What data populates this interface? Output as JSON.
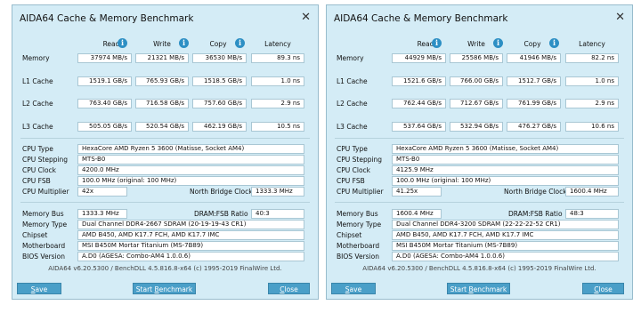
{
  "windows": [
    {
      "title": "AIDA64 Cache & Memory Benchmark",
      "close_glyph": "✕",
      "headers": [
        "Read",
        "Write",
        "Copy",
        "Latency"
      ],
      "info_glyph": "i",
      "rows": [
        {
          "label": "Memory",
          "read": "37974 MB/s",
          "write": "21321 MB/s",
          "copy": "36530 MB/s",
          "latency": "89.3 ns"
        },
        {
          "label": "L1 Cache",
          "read": "1519.1 GB/s",
          "write": "765.93 GB/s",
          "copy": "1518.5 GB/s",
          "latency": "1.0 ns"
        },
        {
          "label": "L2 Cache",
          "read": "763.40 GB/s",
          "write": "716.58 GB/s",
          "copy": "757.60 GB/s",
          "latency": "2.9 ns"
        },
        {
          "label": "L3 Cache",
          "read": "505.05 GB/s",
          "write": "520.54 GB/s",
          "copy": "462.19 GB/s",
          "latency": "10.5 ns"
        }
      ],
      "cpu": {
        "type_label": "CPU Type",
        "type": "HexaCore AMD Ryzen 5 3600  (Matisse, Socket AM4)",
        "stepping_label": "CPU Stepping",
        "stepping": "MTS-B0",
        "clock_label": "CPU Clock",
        "clock": "4200.0 MHz",
        "fsb_label": "CPU FSB",
        "fsb": "100.0 MHz  (original: 100 MHz)",
        "multiplier_label": "CPU Multiplier",
        "multiplier": "42x",
        "nb_label": "North Bridge Clock",
        "nb": "1333.3 MHz"
      },
      "memory": {
        "bus_label": "Memory Bus",
        "bus": "1333.3 MHz",
        "ratio_label": "DRAM:FSB Ratio",
        "ratio": "40:3",
        "type_label": "Memory Type",
        "type": "Dual Channel DDR4-2667 SDRAM  (20-19-19-43 CR1)",
        "chipset_label": "Chipset",
        "chipset": "AMD B450, AMD K17.7 FCH, AMD K17.7 IMC",
        "mobo_label": "Motherboard",
        "mobo": "MSI B450M Mortar Titanium (MS-7B89)",
        "bios_label": "BIOS Version",
        "bios": "A.D0  (AGESA: Combo-AM4 1.0.0.6)"
      },
      "footer": "AIDA64 v6.20.5300 / BenchDLL 4.5.816.8-x64  (c) 1995-2019 FinalWire Ltd.",
      "buttons": {
        "save_ul": "S",
        "save_rest": "ave",
        "bench_pre": "Start ",
        "bench_ul": "B",
        "bench_rest": "enchmark",
        "close_ul": "C",
        "close_rest": "lose"
      }
    },
    {
      "title": "AIDA64 Cache & Memory Benchmark",
      "close_glyph": "✕",
      "headers": [
        "Read",
        "Write",
        "Copy",
        "Latency"
      ],
      "info_glyph": "i",
      "rows": [
        {
          "label": "Memory",
          "read": "44929 MB/s",
          "write": "25586 MB/s",
          "copy": "41946 MB/s",
          "latency": "82.2 ns"
        },
        {
          "label": "L1 Cache",
          "read": "1521.6 GB/s",
          "write": "766.00 GB/s",
          "copy": "1512.7 GB/s",
          "latency": "1.0 ns"
        },
        {
          "label": "L2 Cache",
          "read": "762.44 GB/s",
          "write": "712.67 GB/s",
          "copy": "761.99 GB/s",
          "latency": "2.9 ns"
        },
        {
          "label": "L3 Cache",
          "read": "537.64 GB/s",
          "write": "532.94 GB/s",
          "copy": "476.27 GB/s",
          "latency": "10.6 ns"
        }
      ],
      "cpu": {
        "type_label": "CPU Type",
        "type": "HexaCore AMD Ryzen 5 3600  (Matisse, Socket AM4)",
        "stepping_label": "CPU Stepping",
        "stepping": "MTS-B0",
        "clock_label": "CPU Clock",
        "clock": "4125.9 MHz",
        "fsb_label": "CPU FSB",
        "fsb": "100.0 MHz  (original: 100 MHz)",
        "multiplier_label": "CPU Multiplier",
        "multiplier": "41.25x",
        "nb_label": "North Bridge Clock",
        "nb": "1600.4 MHz"
      },
      "memory": {
        "bus_label": "Memory Bus",
        "bus": "1600.4 MHz",
        "ratio_label": "DRAM:FSB Ratio",
        "ratio": "48:3",
        "type_label": "Memory Type",
        "type": "Dual Channel DDR4-3200 SDRAM  (22-22-22-52 CR1)",
        "chipset_label": "Chipset",
        "chipset": "AMD B450, AMD K17.7 FCH, AMD K17.7 IMC",
        "mobo_label": "Motherboard",
        "mobo": "MSI B450M Mortar Titanium (MS-7B89)",
        "bios_label": "BIOS Version",
        "bios": "A.D0  (AGESA: Combo-AM4 1.0.0.6)"
      },
      "footer": "AIDA64 v6.20.5300 / BenchDLL 4.5.816.8-x64  (c) 1995-2019 FinalWire Ltd.",
      "buttons": {
        "save_ul": "S",
        "save_rest": "ave",
        "bench_pre": "Start ",
        "bench_ul": "B",
        "bench_rest": "enchmark",
        "close_ul": "C",
        "close_rest": "lose"
      }
    }
  ]
}
